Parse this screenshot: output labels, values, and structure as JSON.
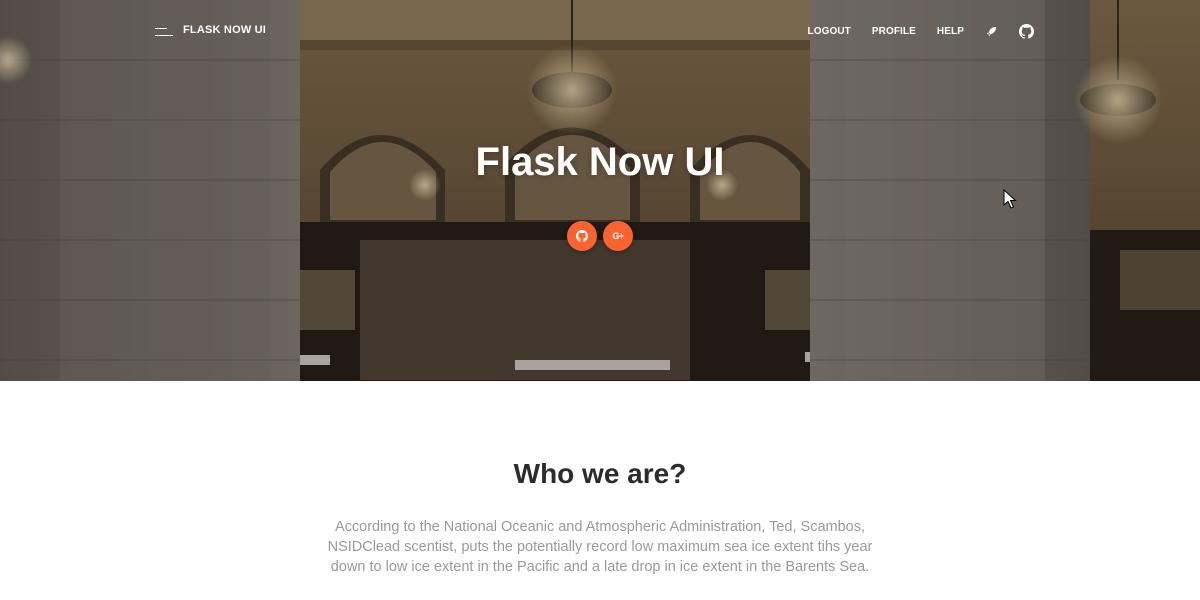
{
  "navbar": {
    "brand": "FLASK NOW UI",
    "links": [
      "LOGOUT",
      "PROFILE",
      "HELP"
    ],
    "icons": [
      "rocket-icon",
      "github-icon"
    ]
  },
  "hero": {
    "title": "Flask Now UI",
    "buttons": [
      {
        "icon": "github-icon"
      },
      {
        "icon": "google-plus-icon",
        "text": "G+"
      }
    ]
  },
  "section": {
    "title": "Who we are?",
    "text": "According to the National Oceanic and Atmospheric Administration, Ted, Scambos, NSIDClead scentist, puts the potentially record low maximum sea ice extent tihs year down to low ice extent in the Pacific and a late drop in ice extent in the Barents Sea."
  },
  "colors": {
    "accent": "#f96332",
    "heading": "#2c2c2c",
    "body_text": "#9a9a9a"
  }
}
